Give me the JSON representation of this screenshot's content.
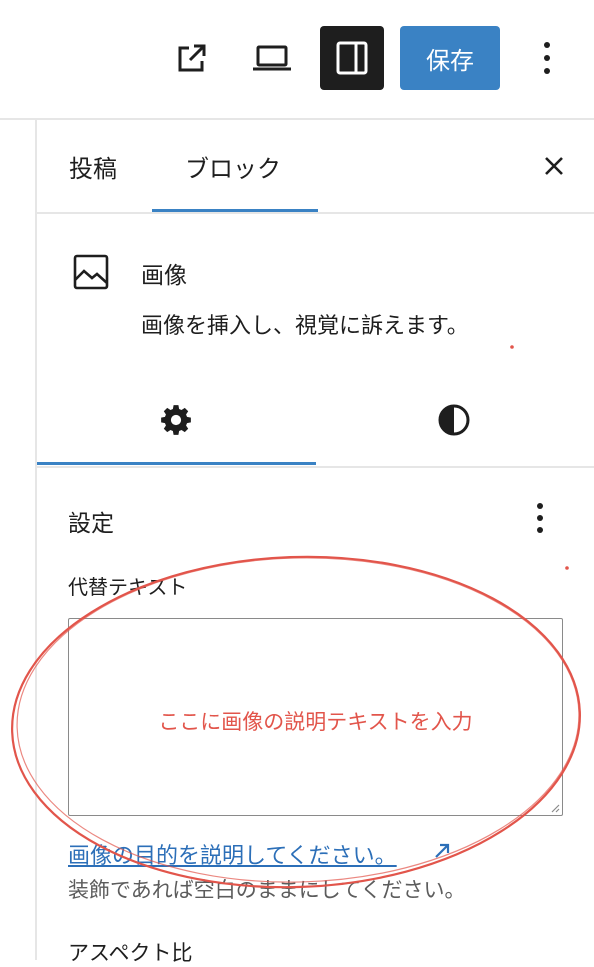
{
  "toolbar": {
    "save_label": "保存",
    "icons": [
      "external-link-icon",
      "laptop-icon",
      "sidebar-panel-icon",
      "more-vertical-icon"
    ]
  },
  "sidebar": {
    "tabs": [
      {
        "label": "投稿"
      },
      {
        "label": "ブロック",
        "active": true
      }
    ]
  },
  "block": {
    "title": "画像",
    "description": "画像を挿入し、視覚に訴えます。",
    "icon": "image-icon"
  },
  "settings": {
    "title": "設定",
    "alt_label": "代替テキスト",
    "alt_value": "",
    "alt_annotation": "ここに画像の説明テキストを入力",
    "help_link": "画像の目的を説明してください。",
    "help_note": "装飾であれば空白のままにしてください。",
    "aspect_label": "アスペクト比"
  },
  "colors": {
    "accent": "#3a82c4",
    "annotation": "#e2554b",
    "dark": "#1e1e1e",
    "border": "#e6e6e6"
  }
}
